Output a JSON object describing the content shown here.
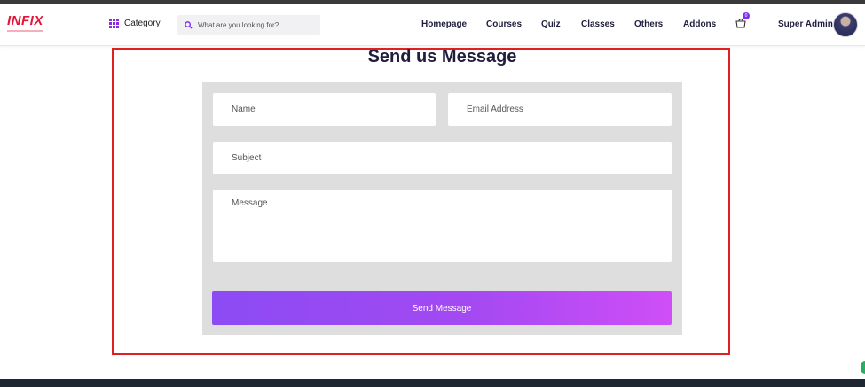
{
  "brand": {
    "logo_text": "INFIX",
    "accent": "#e3163a"
  },
  "header": {
    "category_label": "Category",
    "search_placeholder": "What are you looking for?",
    "nav": [
      "Homepage",
      "Courses",
      "Quiz",
      "Classes",
      "Others",
      "Addons"
    ],
    "cart_count": "0",
    "user_name": "Super Admin"
  },
  "contact": {
    "title": "Send us Message",
    "name_placeholder": "Name",
    "email_placeholder": "Email Address",
    "subject_placeholder": "Subject",
    "message_placeholder": "Message",
    "submit_label": "Send Message"
  },
  "colors": {
    "highlight_border": "#e02020",
    "button_gradient_start": "#8c4bf3",
    "button_gradient_end": "#cf4ef7"
  },
  "icons": [
    "grid-icon",
    "search-icon",
    "cart-icon",
    "avatar"
  ]
}
